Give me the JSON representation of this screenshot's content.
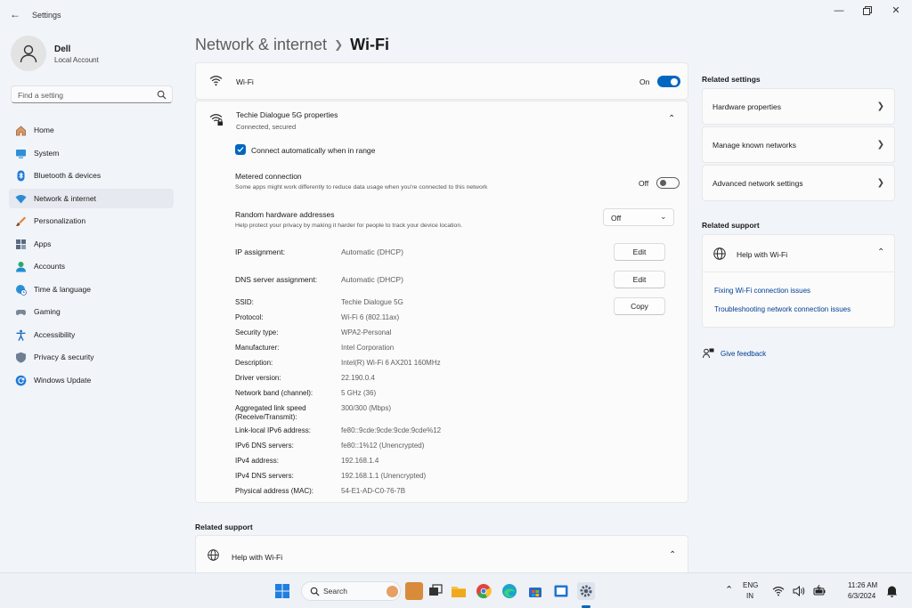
{
  "window": {
    "title": "Settings"
  },
  "user": {
    "name": "Dell",
    "account": "Local Account"
  },
  "search": {
    "placeholder": "Find a setting"
  },
  "nav": [
    {
      "label": "Home",
      "icon": "home-icon"
    },
    {
      "label": "System",
      "icon": "monitor-icon"
    },
    {
      "label": "Bluetooth & devices",
      "icon": "bluetooth-icon"
    },
    {
      "label": "Network & internet",
      "icon": "wifi-icon",
      "selected": true
    },
    {
      "label": "Personalization",
      "icon": "brush-icon"
    },
    {
      "label": "Apps",
      "icon": "apps-icon"
    },
    {
      "label": "Accounts",
      "icon": "person-icon"
    },
    {
      "label": "Time & language",
      "icon": "globe-clock-icon"
    },
    {
      "label": "Gaming",
      "icon": "controller-icon"
    },
    {
      "label": "Accessibility",
      "icon": "accessibility-icon"
    },
    {
      "label": "Privacy & security",
      "icon": "shield-icon"
    },
    {
      "label": "Windows Update",
      "icon": "update-icon"
    }
  ],
  "breadcrumb": {
    "parent": "Network & internet",
    "current": "Wi-Fi"
  },
  "wifi": {
    "label": "Wi-Fi",
    "state": "On",
    "enabled": true
  },
  "properties": {
    "title": "Techie Dialogue 5G properties",
    "subtitle": "Connected, secured",
    "auto_connect": {
      "label": "Connect automatically when in range",
      "checked": true
    },
    "metered": {
      "title": "Metered connection",
      "description": "Some apps might work differently to reduce data usage when you're connected to this network",
      "state": "Off",
      "enabled": false
    },
    "random_hw": {
      "title": "Random hardware addresses",
      "description": "Help protect your privacy by making it harder for people to track your device location.",
      "value": "Off"
    },
    "ip_assignment": {
      "label": "IP assignment:",
      "value": "Automatic (DHCP)",
      "button": "Edit"
    },
    "dns_assignment": {
      "label": "DNS server assignment:",
      "value": "Automatic (DHCP)",
      "button": "Edit"
    },
    "copy_button": "Copy",
    "details": [
      {
        "label": "SSID:",
        "value": "Techie Dialogue 5G"
      },
      {
        "label": "Protocol:",
        "value": "Wi-Fi 6 (802.11ax)"
      },
      {
        "label": "Security type:",
        "value": "WPA2-Personal"
      },
      {
        "label": "Manufacturer:",
        "value": "Intel Corporation"
      },
      {
        "label": "Description:",
        "value": "Intel(R) Wi-Fi 6 AX201 160MHz"
      },
      {
        "label": "Driver version:",
        "value": "22.190.0.4"
      },
      {
        "label": "Network band (channel):",
        "value": "5 GHz (36)"
      },
      {
        "label": "Aggregated link speed",
        "label2": "(Receive/Transmit):",
        "value": "300/300 (Mbps)"
      },
      {
        "label": "Link-local IPv6 address:",
        "value": "fe80::9cde:9cde:9cde:9cde%12"
      },
      {
        "label": "IPv6 DNS servers:",
        "value": "fe80::1%12 (Unencrypted)"
      },
      {
        "label": "IPv4 address:",
        "value": "192.168.1.4"
      },
      {
        "label": "IPv4 DNS servers:",
        "value": "192.168.1.1 (Unencrypted)"
      },
      {
        "label": "Physical address (MAC):",
        "value": "54-E1-AD-C0-76-7B"
      }
    ]
  },
  "bottom_support": {
    "heading": "Related support",
    "help": "Help with Wi-Fi"
  },
  "related_settings": {
    "heading": "Related settings",
    "items": [
      "Hardware properties",
      "Manage known networks",
      "Advanced network settings"
    ]
  },
  "related_support": {
    "heading": "Related support",
    "help": "Help with Wi-Fi",
    "links": [
      "Fixing Wi-Fi connection issues",
      "Troubleshooting network connection issues"
    ]
  },
  "feedback": "Give feedback",
  "taskbar": {
    "search": "Search",
    "lang": "ENG",
    "region": "IN",
    "time": "11:26 AM",
    "date": "6/3/2024"
  },
  "colors": {
    "accent": "#0067c0",
    "link": "#003e92"
  }
}
